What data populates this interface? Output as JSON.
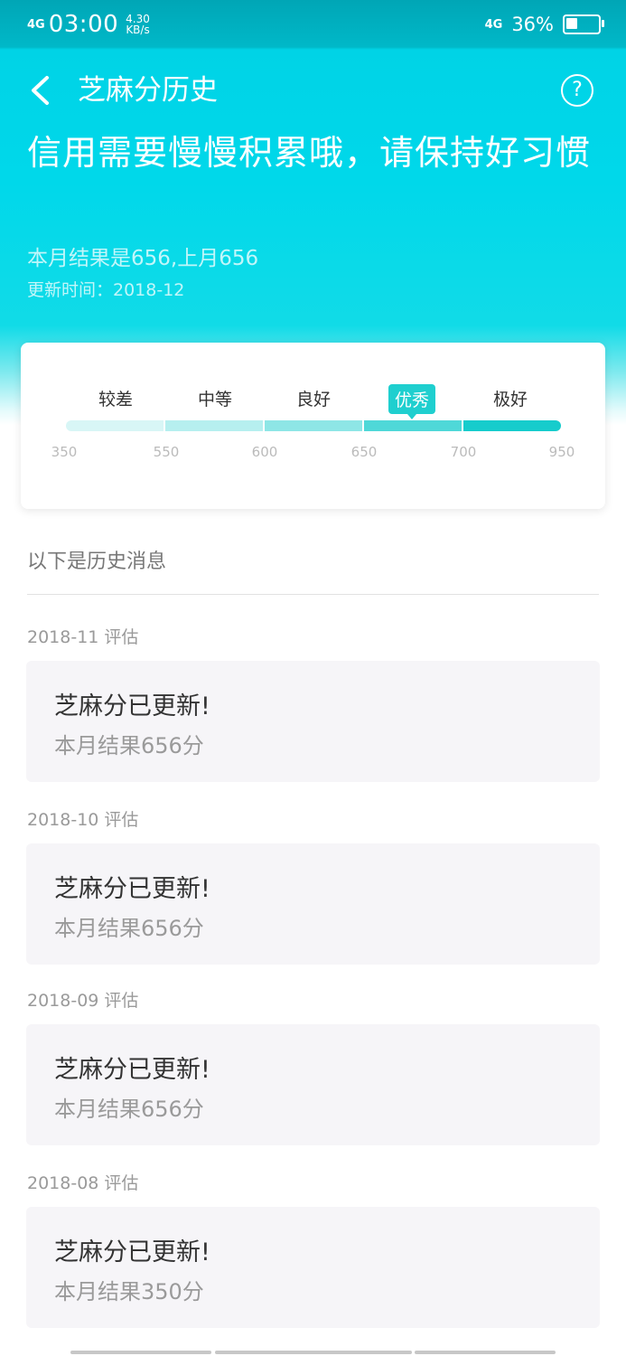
{
  "status_bar": {
    "signal": "4G",
    "time": "03:00",
    "speed_value": "4.30",
    "speed_unit": "KB/s",
    "network_right": "4G",
    "battery_percent": "36%",
    "battery_level": 0.36
  },
  "nav": {
    "title": "芝麻分历史",
    "back_icon": "chevron-left-icon",
    "help_icon": "question-circle-icon",
    "help_glyph": "?"
  },
  "hero": {
    "headline": "信用需要慢慢积累哦，请保持好习惯",
    "result_text": "本月结果是656,上月656",
    "update_text": "更新时间：2018-12"
  },
  "score_scale": {
    "levels": [
      "较差",
      "中等",
      "良好",
      "优秀",
      "极好"
    ],
    "active_level": "优秀",
    "ticks": [
      "350",
      "550",
      "600",
      "650",
      "700",
      "950"
    ],
    "segment_colors": [
      "#d8f6f6",
      "#b6efef",
      "#8ee6e6",
      "#4fd8d8",
      "#16cccc"
    ]
  },
  "history": {
    "heading": "以下是历史消息",
    "entries": [
      {
        "date": "2018-11 评估",
        "title": "芝麻分已更新!",
        "result": "本月结果656分"
      },
      {
        "date": "2018-10 评估",
        "title": "芝麻分已更新!",
        "result": "本月结果656分"
      },
      {
        "date": "2018-09 评估",
        "title": "芝麻分已更新!",
        "result": "本月结果656分"
      },
      {
        "date": "2018-08 评估",
        "title": "芝麻分已更新!",
        "result": "本月结果350分"
      }
    ]
  }
}
